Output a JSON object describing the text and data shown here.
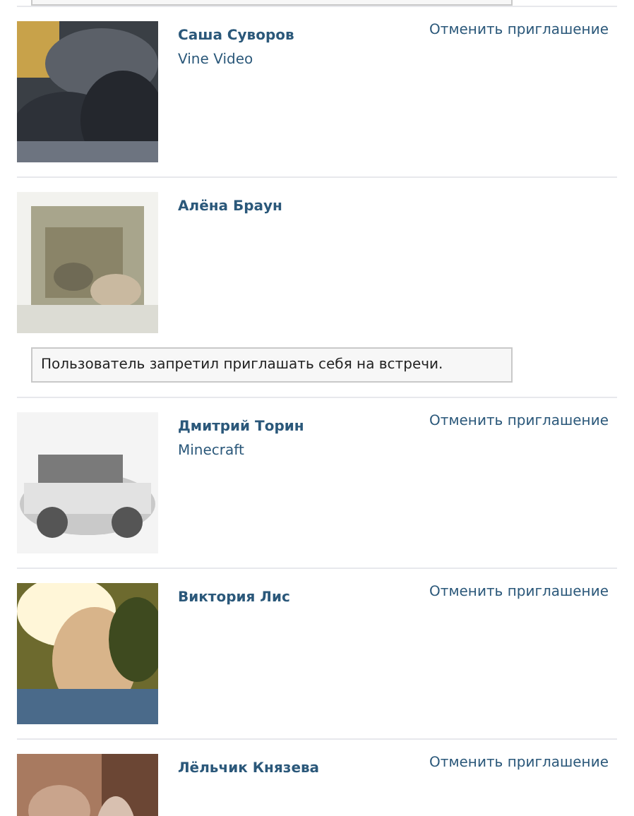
{
  "people": [
    {
      "name": "Саша Суворов",
      "subtitle": "Vine Video",
      "action": "Отменить приглашение"
    },
    {
      "name": "Алёна Браун",
      "notice": "Пользователь запретил приглашать себя на встречи."
    },
    {
      "name": "Дмитрий Торин",
      "subtitle": "Minecraft",
      "action": "Отменить приглашение"
    },
    {
      "name": "Виктория Лис",
      "action": "Отменить приглашение"
    },
    {
      "name": "Лёльчик Князева",
      "action": "Отменить приглашение"
    }
  ]
}
